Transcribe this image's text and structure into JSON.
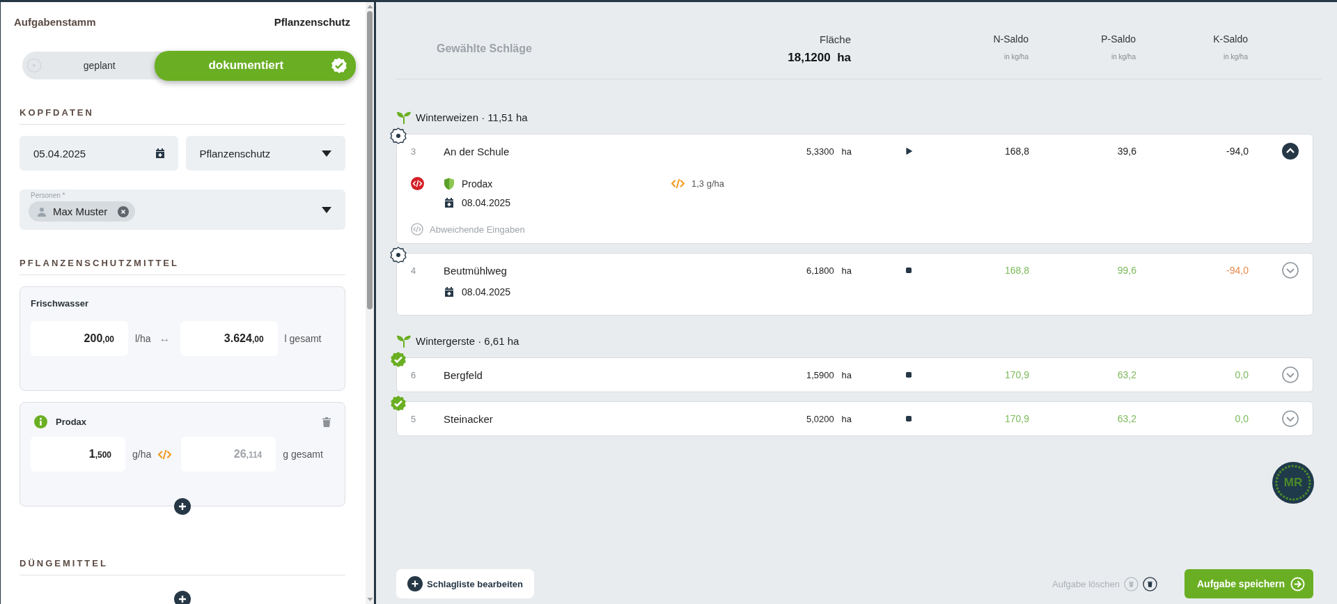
{
  "left_panel": {
    "breadcrumb": "Aufgabenstamm",
    "task_type": "Pflanzenschutz",
    "status_toggle": [
      {
        "label": "geplant",
        "selected": false
      },
      {
        "label": "dokumentiert",
        "selected": true
      }
    ],
    "kopfdaten": {
      "heading": "KOPFDATEN",
      "date": "05.04.2025",
      "type_select": "Pflanzenschutz",
      "persons": {
        "label": "Personen *",
        "chips": [
          "Max Muster"
        ]
      }
    },
    "pflanzenschutzmittel": {
      "heading": "PFLANZENSCHUTZMITTEL",
      "water": {
        "title": "Frischwasser",
        "rate": "200,00",
        "rate_unit": "l/ha",
        "link_symbol": "↔",
        "total": "3.624,00",
        "total_unit": "l gesamt",
        "total_disabled": false
      },
      "products": [
        {
          "name": "Prodax",
          "rate": "1,500",
          "rate_unit": "g/ha",
          "total": "26,114",
          "total_unit": "g gesamt",
          "total_disabled": true
        }
      ]
    },
    "duengemittel": {
      "heading": "DÜNGEMITTEL"
    }
  },
  "fields_header": {
    "title": "Gewählte Schläge",
    "area_label": "Fläche",
    "area_total": "18,1200",
    "area_unit": "ha",
    "columns": [
      {
        "label": "N-Saldo",
        "unit": "in kg/ha"
      },
      {
        "label": "P-Saldo",
        "unit": "in kg/ha"
      },
      {
        "label": "K-Saldo",
        "unit": "in kg/ha"
      }
    ]
  },
  "groups": [
    {
      "crop": "Winterweizen · 11,51 ha",
      "fields": [
        {
          "number": "3",
          "name": "An der Schule",
          "area": "5,3300",
          "area_unit": "ha",
          "documented": false,
          "running": true,
          "expanded": true,
          "saldo": [
            {
              "value": "168,8",
              "color": "#222222"
            },
            {
              "value": "39,6",
              "color": "#222222"
            },
            {
              "value": "-94,0",
              "color": "#222222"
            }
          ],
          "details": {
            "deviation": true,
            "product": "Prodax",
            "product_rate": "1,3 g/ha",
            "date": "08.04.2025",
            "note": "Abweichende Eingaben"
          }
        },
        {
          "number": "4",
          "name": "Beutmühlweg",
          "area": "6,1800",
          "area_unit": "ha",
          "documented": false,
          "running": false,
          "expanded": false,
          "saldo": [
            {
              "value": "168,8",
              "color": "#7cb95a"
            },
            {
              "value": "99,6",
              "color": "#7cb95a"
            },
            {
              "value": "-94,0",
              "color": "#e8884a"
            }
          ],
          "details": {
            "date": "08.04.2025"
          }
        }
      ]
    },
    {
      "crop": "Wintergerste · 6,61 ha",
      "fields": [
        {
          "number": "6",
          "name": "Bergfeld",
          "area": "1,5900",
          "area_unit": "ha",
          "documented": true,
          "running": false,
          "expanded": false,
          "saldo": [
            {
              "value": "170,9",
              "color": "#7cb95a"
            },
            {
              "value": "63,2",
              "color": "#7cb95a"
            },
            {
              "value": "0,0",
              "color": "#7cb95a"
            }
          ]
        },
        {
          "number": "5",
          "name": "Steinacker",
          "area": "5,0200",
          "area_unit": "ha",
          "documented": true,
          "running": false,
          "expanded": false,
          "saldo": [
            {
              "value": "170,9",
              "color": "#7cb95a"
            },
            {
              "value": "63,2",
              "color": "#7cb95a"
            },
            {
              "value": "0,0",
              "color": "#7cb95a"
            }
          ]
        }
      ]
    }
  ],
  "logo_text": "MR",
  "actions": {
    "edit_list": "Schlagliste bearbeiten",
    "delete": "Aufgabe löschen",
    "save": "Aufgabe speichern"
  }
}
